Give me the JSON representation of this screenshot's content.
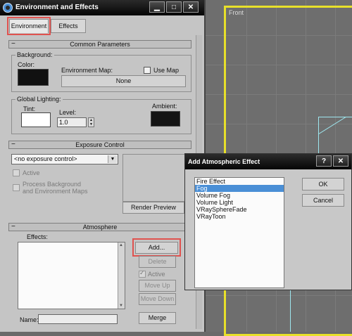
{
  "viewport": {
    "label": "Front"
  },
  "window": {
    "title": "Environment and Effects",
    "buttons": {
      "minimize": "▁",
      "maximize": "□",
      "close": "✕"
    }
  },
  "tabs": [
    {
      "label": "Environment"
    },
    {
      "label": "Effects"
    }
  ],
  "common_params": {
    "header": "Common Parameters",
    "background_group": "Background:",
    "color_label": "Color:",
    "env_map_label": "Environment Map:",
    "use_map_label": "Use Map",
    "env_map_button": "None",
    "global_lighting_group": "Global Lighting:",
    "tint_label": "Tint:",
    "level_label": "Level:",
    "level_value": "1.0",
    "ambient_label": "Ambient:",
    "colors": {
      "background": "#111111",
      "tint": "#ffffff",
      "ambient": "#141414"
    }
  },
  "exposure": {
    "header": "Exposure Control",
    "dropdown_value": "<no exposure control>",
    "active_label": "Active",
    "process_label_1": "Process Background",
    "process_label_2": "and Environment Maps",
    "render_preview": "Render Preview"
  },
  "atmosphere": {
    "header": "Atmosphere",
    "effects_label": "Effects:",
    "add": "Add...",
    "delete": "Delete",
    "active": "Active",
    "move_up": "Move Up",
    "move_down": "Move Down",
    "name_label": "Name:",
    "name_value": "",
    "merge": "Merge"
  },
  "add_dialog": {
    "title": "Add Atmospheric Effect",
    "help": "?",
    "close": "✕",
    "items": [
      "Fire Effect",
      "Fog",
      "Volume Fog",
      "Volume Light",
      "VRaySphereFade",
      "VRayToon"
    ],
    "selected": "Fog",
    "ok": "OK",
    "cancel": "Cancel"
  },
  "colors": {
    "highlight": "#e0524f",
    "selection": "#4a8fd6",
    "viewport_border": "#e8e02a"
  },
  "minus_symbol": "−"
}
